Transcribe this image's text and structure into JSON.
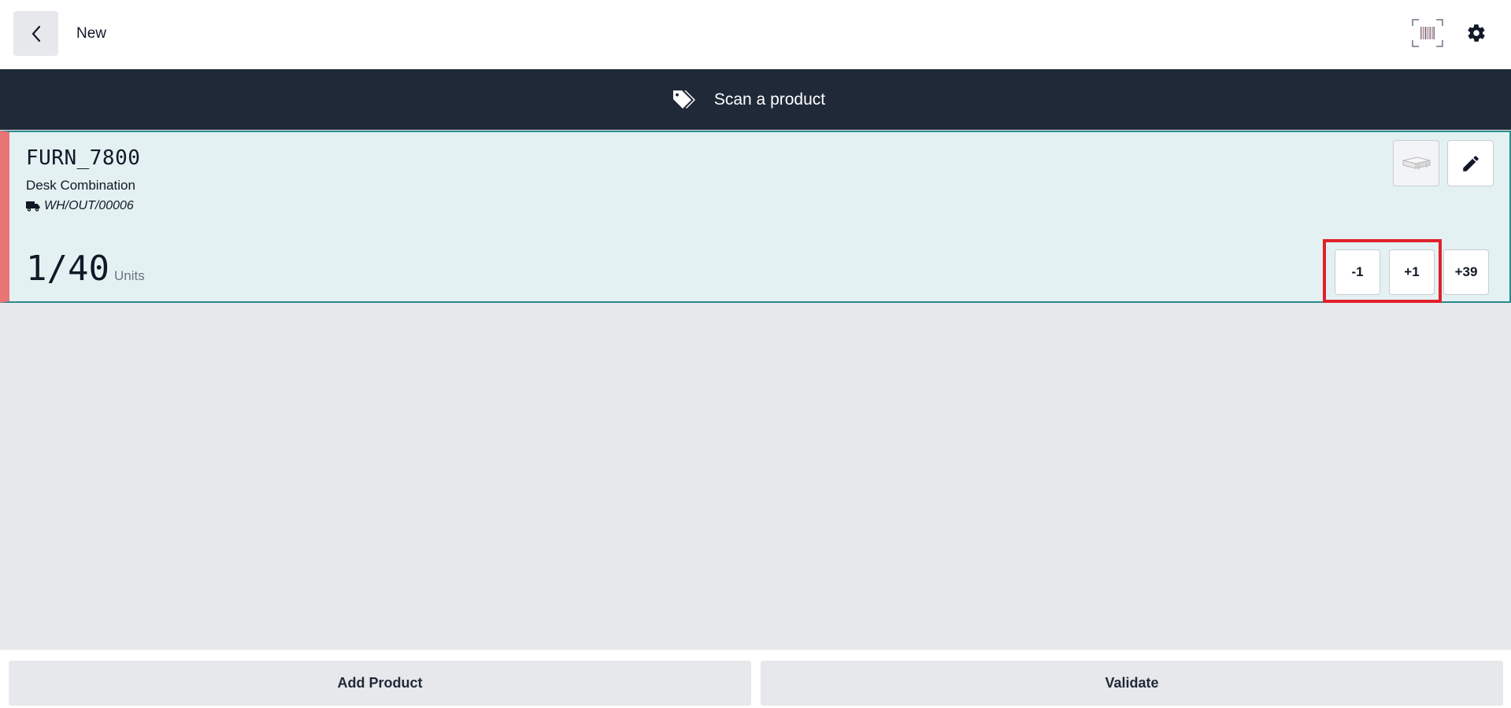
{
  "header": {
    "title": "New",
    "back_icon": "chevron-left-icon",
    "barcode_icon": "barcode-scanner-icon",
    "settings_icon": "gear-icon"
  },
  "scan_banner": {
    "icon": "tags-icon",
    "text": "Scan a product"
  },
  "line": {
    "reference": "FURN_7800",
    "name": "Desk Combination",
    "picking": "WH/OUT/00006",
    "picking_icon": "truck-icon",
    "quantity": "1/40",
    "unit": "Units",
    "buttons": {
      "minus": "-1",
      "plus": "+1",
      "remaining": "+39"
    },
    "colors": {
      "status_bar": "#e87474",
      "highlight": "#e0202a"
    }
  },
  "footer": {
    "add_product": "Add Product",
    "validate": "Validate"
  }
}
